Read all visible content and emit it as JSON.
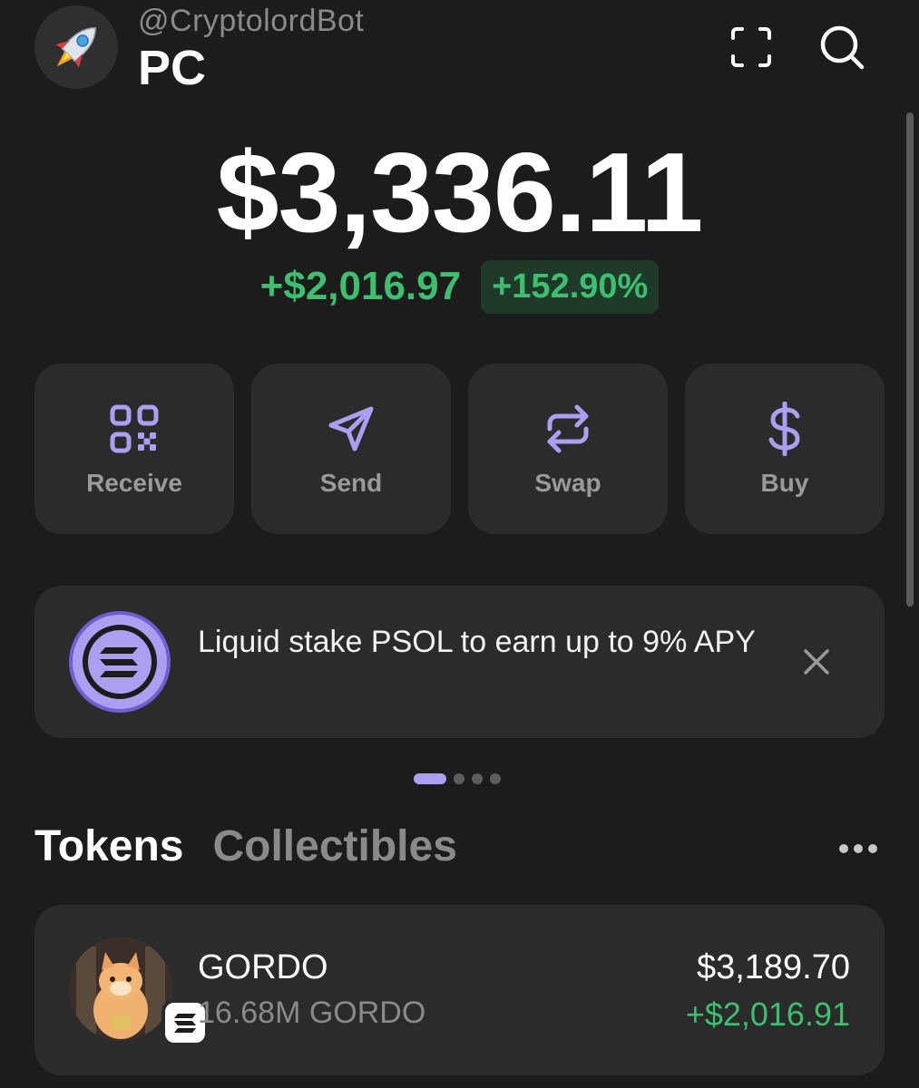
{
  "header": {
    "handle": "@CryptolordBot",
    "account_name": "PC",
    "avatar_emoji": "🚀",
    "icons": [
      "scan-icon",
      "search-icon"
    ]
  },
  "balance": {
    "total": "$3,336.11",
    "change_amount": "+$2,016.97",
    "change_percent": "+152.90%"
  },
  "actions": [
    {
      "label": "Receive",
      "icon": "qr-code-icon"
    },
    {
      "label": "Send",
      "icon": "send-icon"
    },
    {
      "label": "Swap",
      "icon": "swap-icon"
    },
    {
      "label": "Buy",
      "icon": "dollar-icon"
    }
  ],
  "promo": {
    "text": "Liquid stake PSOL to earn up to 9% APY",
    "icon": "solana-logo-icon"
  },
  "carousel": {
    "count": 4,
    "active_index": 0
  },
  "tabs": [
    {
      "label": "Tokens",
      "active": true
    },
    {
      "label": "Collectibles",
      "active": false
    }
  ],
  "tokens": [
    {
      "name": "GORDO",
      "amount": "16.68M GORDO",
      "value": "$3,189.70",
      "change": "+$2,016.91",
      "chain": "solana"
    }
  ],
  "colors": {
    "background": "#1c1c1c",
    "card": "#2b2b2b",
    "accent": "#ab9ff2",
    "positive": "#3cbf6e",
    "muted": "#8a8a8a"
  }
}
